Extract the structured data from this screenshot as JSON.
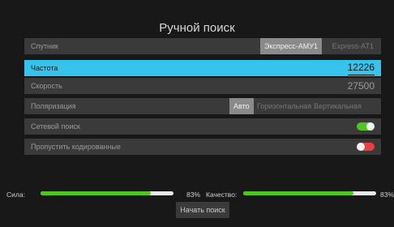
{
  "title": "Ручной поиск",
  "rows": {
    "satellite": {
      "label": "Спутник",
      "options": [
        "Экспресс-АМУ1",
        "Express-AT1"
      ],
      "selected": "Экспресс-АМУ1"
    },
    "frequency": {
      "label": "Частота",
      "value": "12226"
    },
    "symbol_rate": {
      "label": "Скорость",
      "value": "27500"
    },
    "polarization": {
      "label": "Поляризация",
      "options": [
        "Авто",
        "Горизонтальная",
        "Вертикальная"
      ],
      "selected": "Авто"
    },
    "network_search": {
      "label": "Сетевой поиск",
      "enabled": true
    },
    "skip_encrypted": {
      "label": "Пропустить кодированные",
      "enabled": false
    }
  },
  "signal": {
    "strength_label": "Сила:",
    "strength_value": "83%",
    "strength_fraction": 0.83,
    "quality_label": "Качество:",
    "quality_value": "83%",
    "quality_fraction": 0.83
  },
  "start_button": "Начать поиск",
  "colors": {
    "accent": "#37c4ec",
    "toggle_on": "#4fc51e",
    "toggle_off": "#e84141",
    "meter_fill": "#4fc51e"
  }
}
